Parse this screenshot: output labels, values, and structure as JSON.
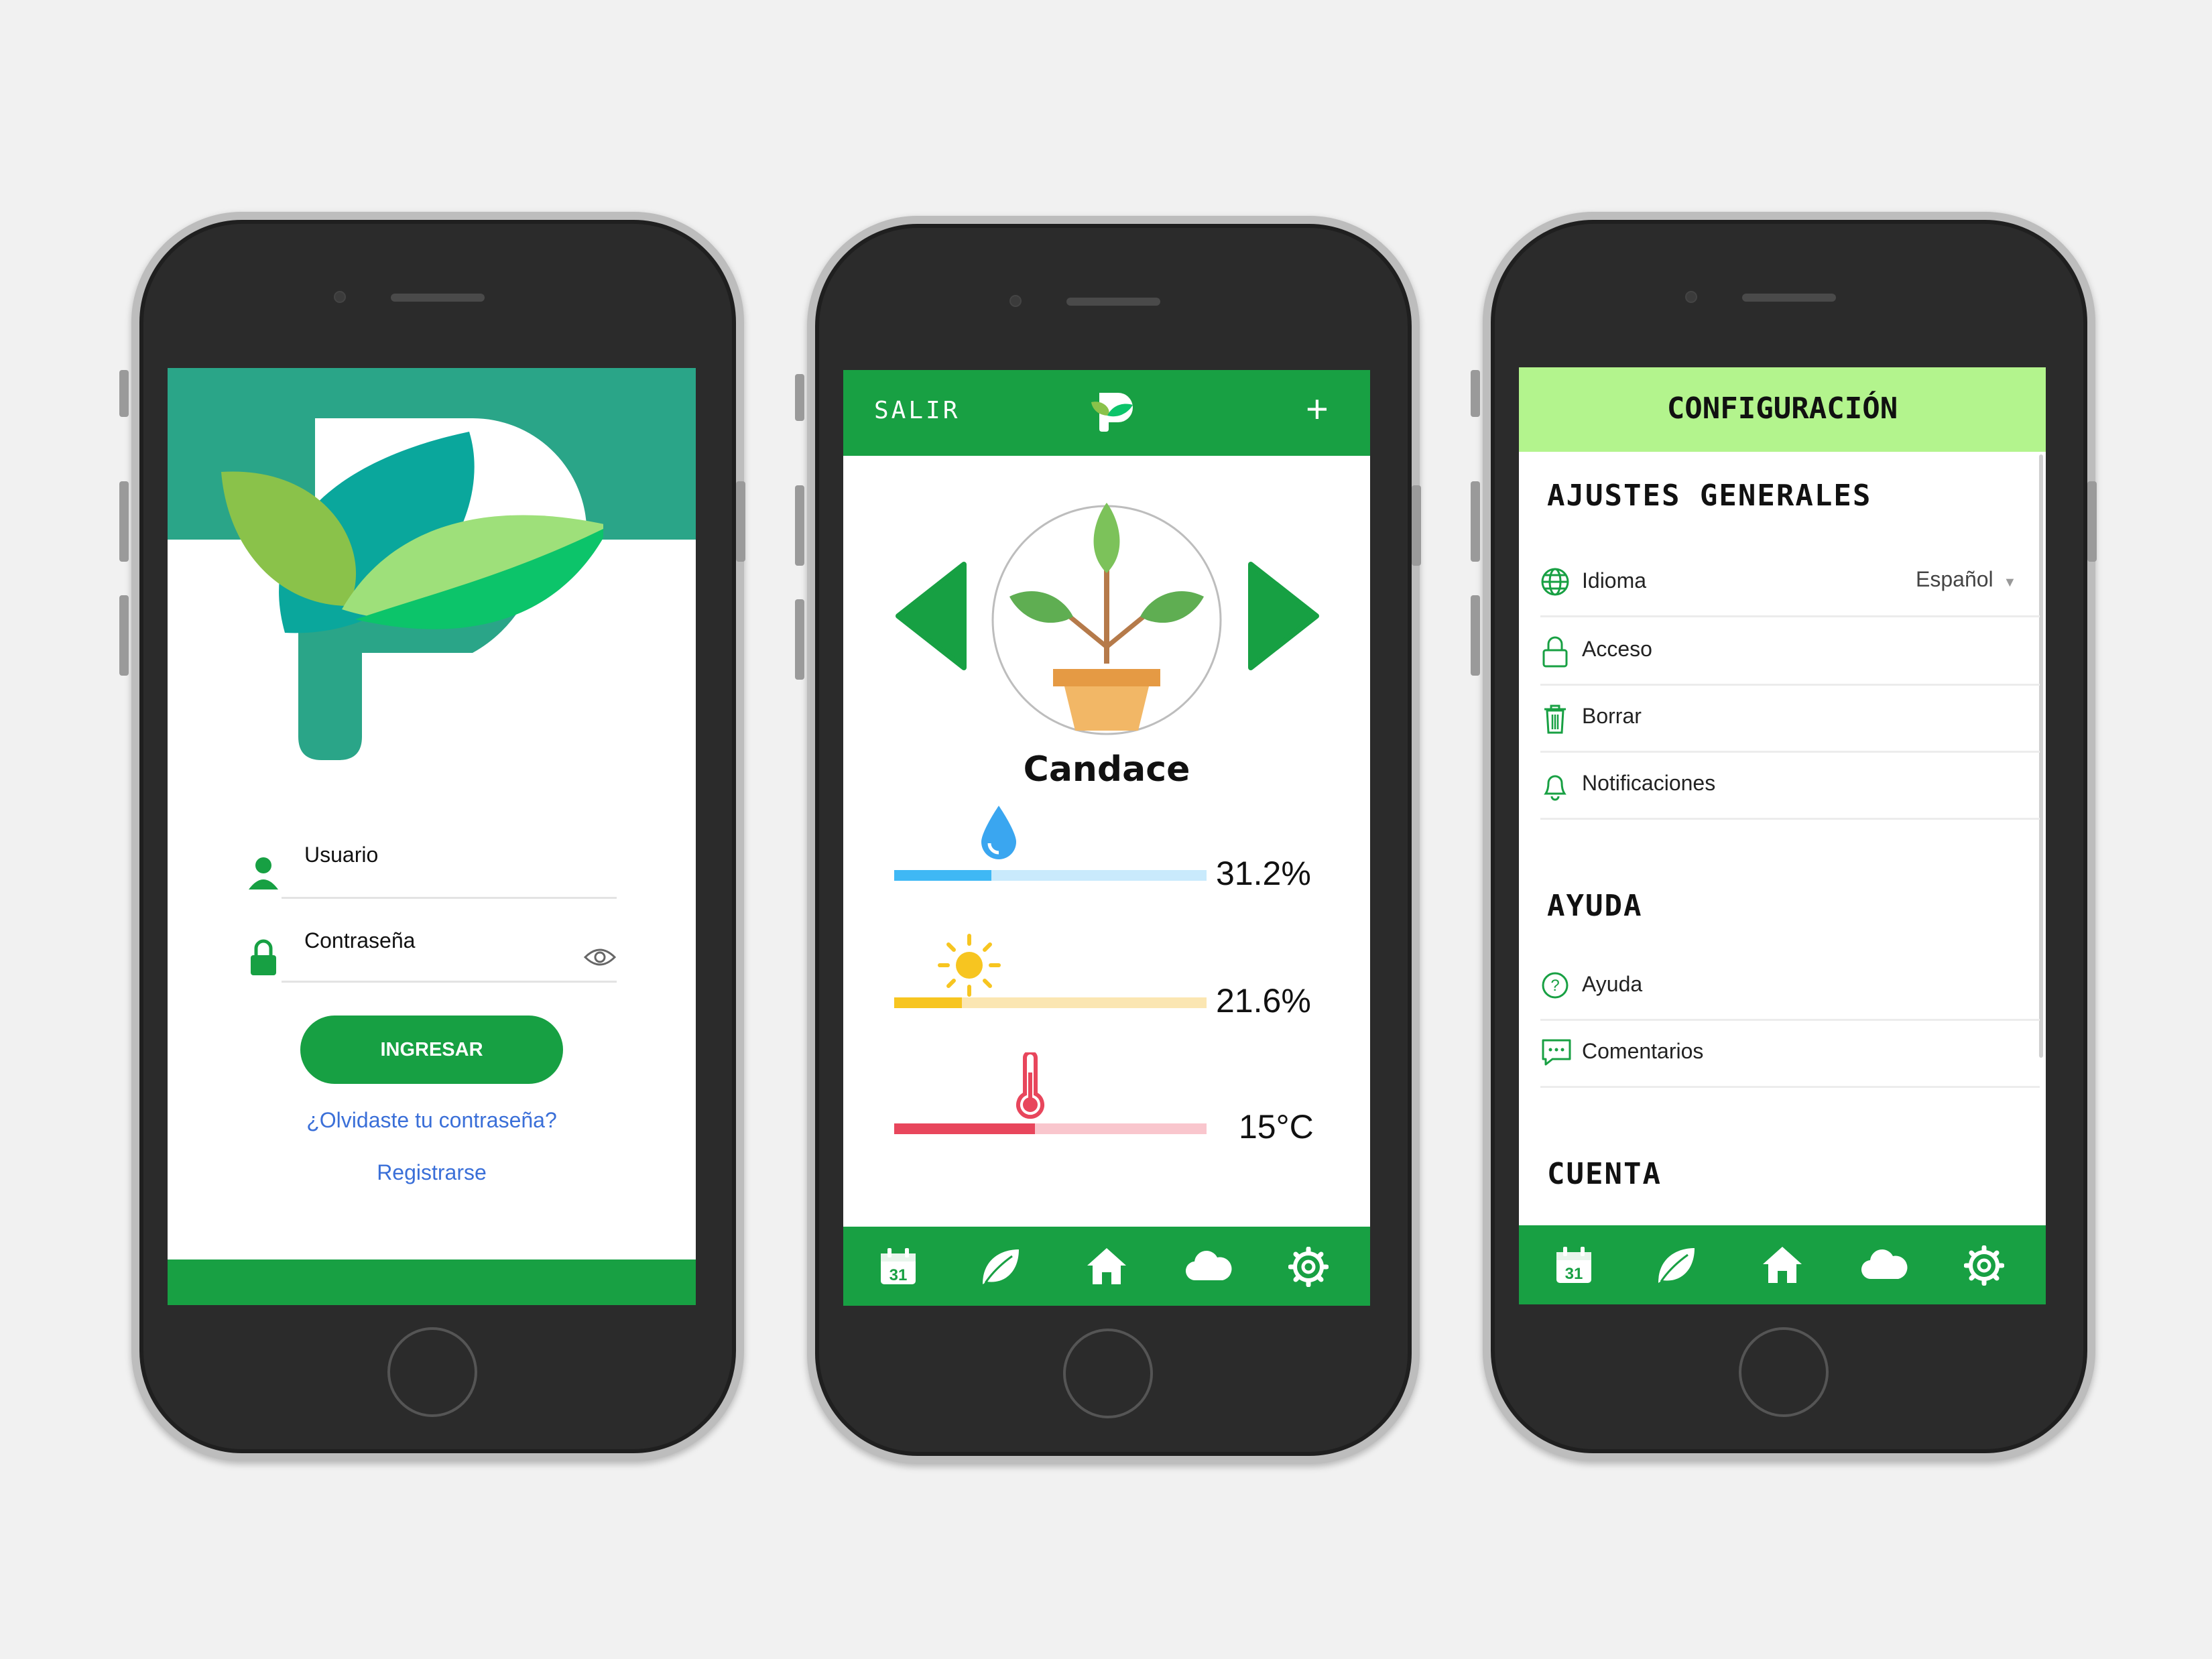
{
  "login": {
    "username_label": "Usuario",
    "password_label": "Contraseña",
    "login_button": "INGRESAR",
    "forgot_link": "¿Olvidaste tu contraseña?",
    "register_link": "Registrarse"
  },
  "home": {
    "logout_label": "SALIR",
    "plant_name": "Candace",
    "humidity": {
      "value": 0.312,
      "label": "31.2%"
    },
    "light": {
      "value": 0.216,
      "label": "21.6%"
    },
    "temperature": {
      "value": 0.45,
      "label": "15°C"
    }
  },
  "settings": {
    "title": "CONFIGURACIÓN",
    "general_title": "AJUSTES GENERALES",
    "language_label": "Idioma",
    "language_value": "Español",
    "access_label": "Acceso",
    "delete_label": "Borrar",
    "notifications_label": "Notificaciones",
    "help_title": "AYUDA",
    "help_label": "Ayuda",
    "comments_label": "Comentarios",
    "account_title": "CUENTA"
  },
  "colors": {
    "brand_green": "#18a043",
    "settings_header": "#b3f48d",
    "humidity": "#3fb8f5",
    "light": "#f7c520",
    "temperature": "#e8465c"
  }
}
